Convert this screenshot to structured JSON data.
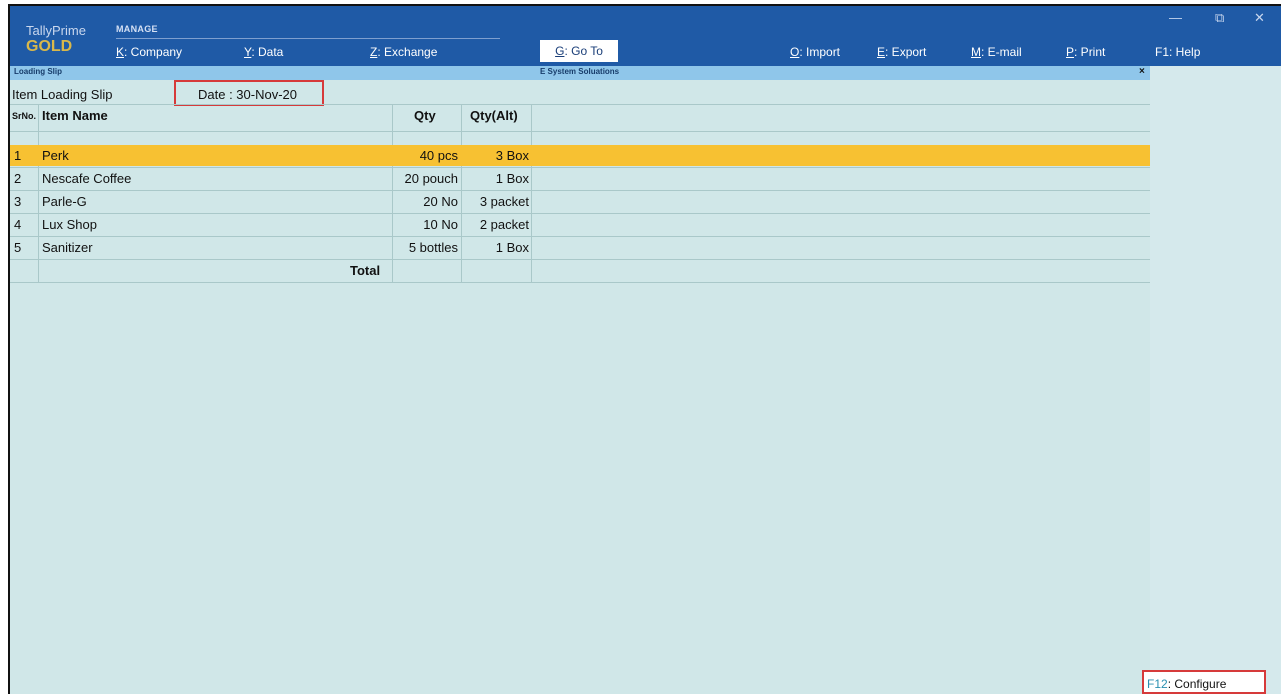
{
  "header": {
    "brand_top": "TallyPrime",
    "brand_bottom": "GOLD",
    "section": "MANAGE",
    "menus": [
      {
        "key": "K",
        "label": ": Company"
      },
      {
        "key": "Y",
        "label": ": Data"
      },
      {
        "key": "Z",
        "label": ": Exchange"
      },
      {
        "key": "G",
        "label": ": Go To"
      },
      {
        "key": "O",
        "label": ": Import"
      },
      {
        "key": "E",
        "label": ": Export"
      },
      {
        "key": "M",
        "label": ": E-mail"
      },
      {
        "key": "P",
        "label": ": Print"
      },
      {
        "key": "F1",
        "label": ": Help"
      }
    ],
    "window_controls": [
      "—",
      "⧉",
      "✕"
    ]
  },
  "strip": {
    "title": "Loading Slip",
    "company": "E System Soluations",
    "close": "×"
  },
  "report": {
    "title": "Item Loading Slip",
    "date": "Date : 30-Nov-20",
    "columns": {
      "sr": "SrNo.",
      "item": "Item Name",
      "qty": "Qty",
      "qty_alt": "Qty(Alt)"
    },
    "rows": [
      {
        "sr": "1",
        "item": "Perk",
        "qty": "40 pcs",
        "qty_alt": "3 Box"
      },
      {
        "sr": "2",
        "item": "Nescafe Coffee",
        "qty": "20 pouch",
        "qty_alt": "1 Box"
      },
      {
        "sr": "3",
        "item": "Parle-G",
        "qty": "20 No",
        "qty_alt": "3 packet"
      },
      {
        "sr": "4",
        "item": "Lux Shop",
        "qty": "10 No",
        "qty_alt": "2 packet"
      },
      {
        "sr": "5",
        "item": "Sanitizer",
        "qty": "5 bottles",
        "qty_alt": "1 Box"
      }
    ],
    "total_label": "Total"
  },
  "footer": {
    "configure_key": "F12",
    "configure_label": ": Configure"
  },
  "colors": {
    "topbar": "#1f5aa6",
    "strip": "#8fc6ea",
    "body": "#d0e7e8",
    "selected_row": "#f7c132",
    "highlight_box": "#d63a3a"
  }
}
